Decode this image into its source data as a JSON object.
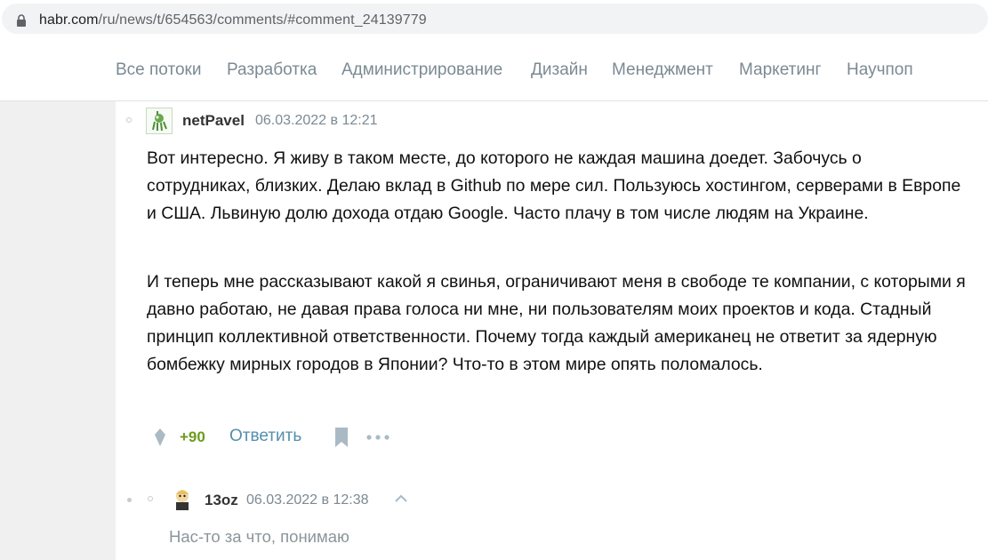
{
  "address_bar": {
    "url_host": "habr.com",
    "url_path": "/ru/news/t/654563/comments/#comment_24139779"
  },
  "nav": {
    "items": [
      "Все потоки",
      "Разработка",
      "Администрирование",
      "Дизайн",
      "Менеджмент",
      "Маркетинг",
      "Научпоп"
    ]
  },
  "comment": {
    "author": "netPavel",
    "date": "06.03.2022 в 12:21",
    "paragraphs": [
      "Вот интересно. Я живу в таком месте, до которого не каждая машина доедет. Забочусь о сотрудниках, близких. Делаю вклад в Github по мере сил. Пользуюсь хостингом, серверами в Европе и США. Львиную долю дохода отдаю Google. Часто плачу в том числе людям на Украине.",
      "И теперь мне рассказывают какой я свинья, ограничивают меня в свободе те компании, с которыми я давно работаю, не давая права голоса ни мне, ни пользователям моих проектов и кода. Стадный принцип коллективной ответственности. Почему тогда каждый американец не ответит за ядерную бомбежку мирных городов в Японии? Что-то в этом мире опять поломалось."
    ],
    "score": "+90",
    "reply_label": "Ответить"
  },
  "reply_comment": {
    "author": "13oz",
    "date": "06.03.2022 в 12:38",
    "text": "Нас-то за что, понимаю"
  },
  "colors": {
    "nav_text": "#7b8a93",
    "score_positive": "#6c9b1b",
    "link": "#548eaa",
    "page_bg": "#f0f0f0"
  },
  "icons": [
    "lock-icon",
    "robot-avatar-icon",
    "vote-icon",
    "bookmark-icon",
    "more-icon",
    "chevron-up-icon",
    "cartoon-avatar-icon"
  ]
}
